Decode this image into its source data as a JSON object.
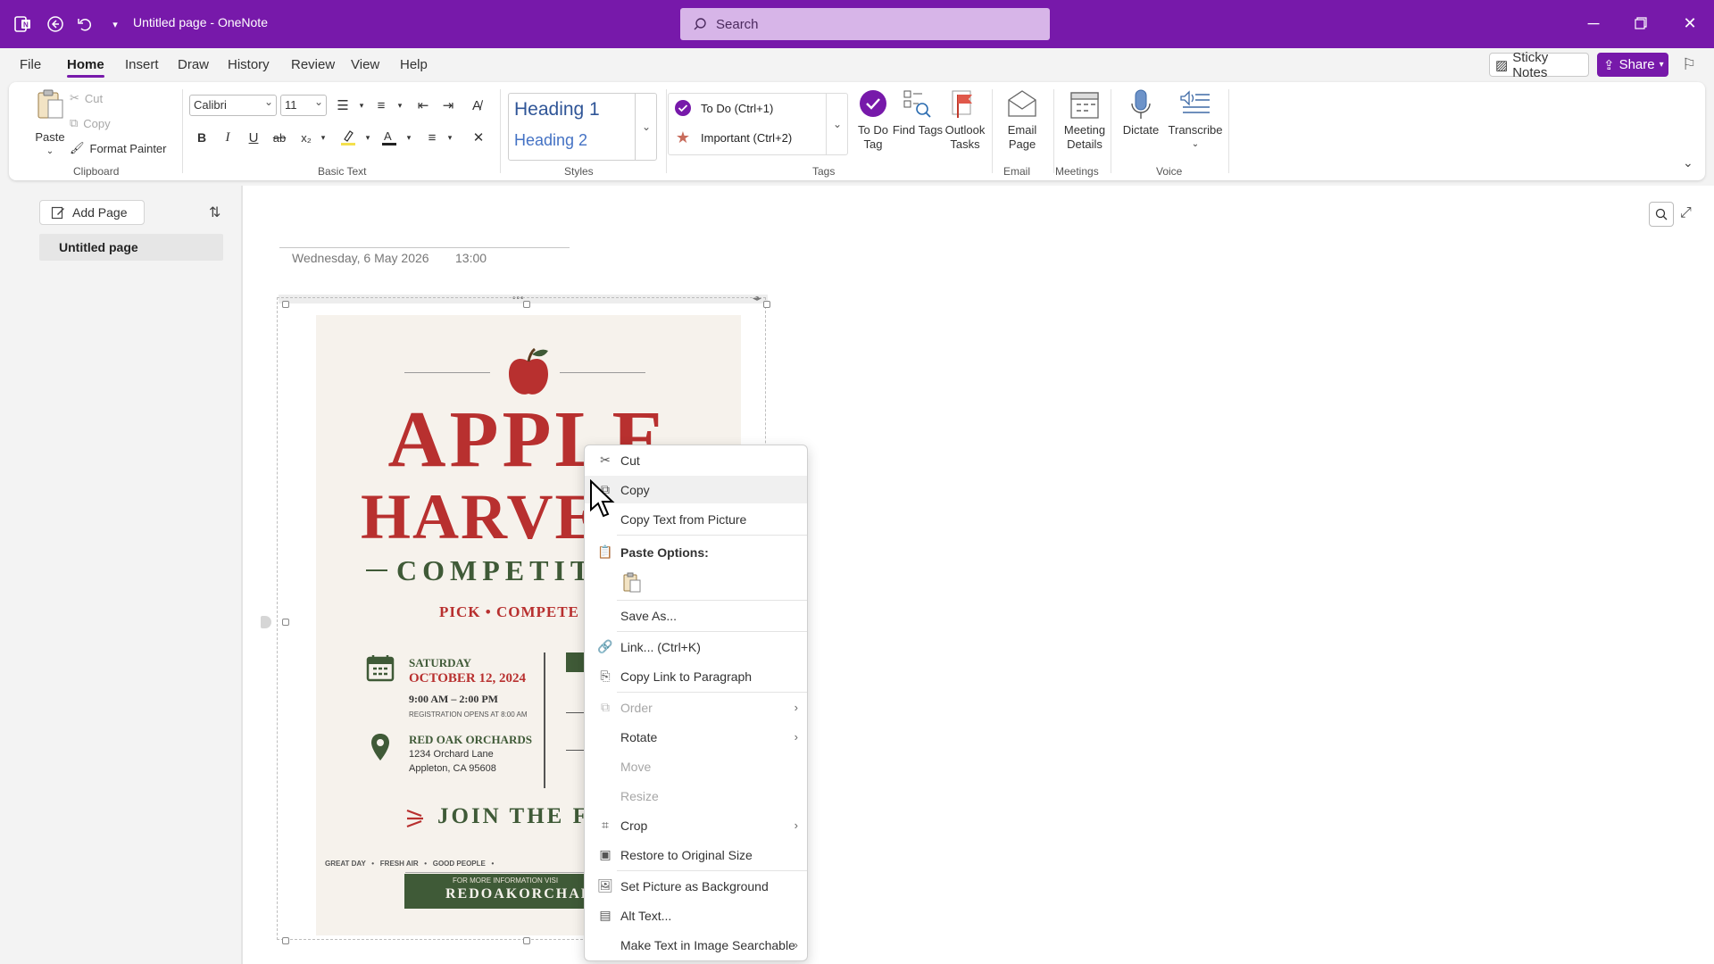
{
  "titlebar": {
    "doc_title": "Untitled page  -  OneNote",
    "search_placeholder": "Search"
  },
  "menu": {
    "tabs": [
      "File",
      "Home",
      "Insert",
      "Draw",
      "History",
      "Review",
      "View",
      "Help"
    ],
    "active": "Home",
    "sticky_notes": "Sticky Notes",
    "share": "Share"
  },
  "ribbon": {
    "clipboard": {
      "paste": "Paste",
      "cut": "Cut",
      "copy": "Copy",
      "format_painter": "Format Painter",
      "group": "Clipboard"
    },
    "basic_text": {
      "font": "Calibri",
      "size": "11",
      "group": "Basic Text"
    },
    "styles": {
      "heading1": "Heading 1",
      "heading2": "Heading 2",
      "group": "Styles"
    },
    "tags": {
      "todo": "To Do (Ctrl+1)",
      "important": "Important (Ctrl+2)",
      "todo_tag": "To Do Tag",
      "find_tags": "Find Tags",
      "outlook_tasks": "Outlook Tasks",
      "group": "Tags"
    },
    "email": {
      "email_page": "Email Page",
      "group": "Email"
    },
    "meetings": {
      "meeting_details": "Meeting Details",
      "group": "Meetings"
    },
    "voice": {
      "dictate": "Dictate",
      "transcribe": "Transcribe",
      "group": "Voice"
    }
  },
  "sidebar": {
    "add_page": "Add Page",
    "pages": [
      "Untitled page"
    ]
  },
  "page": {
    "date": "Wednesday, 6 May 2026",
    "time": "13:00"
  },
  "poster": {
    "title1": "APPLE",
    "title2": "HARVEST",
    "title3": "COMPETITION",
    "tagline": "PICK • COMPETE •",
    "day": "SATURDAY",
    "date": "OCTOBER 12, 2024",
    "hours": "9:00 AM – 2:00 PM",
    "registration": "REGISTRATION OPENS AT 8:00 AM",
    "venue": "RED OAK ORCHARDS",
    "address1": "1234 Orchard Lane",
    "address2": "Appleton, CA 95608",
    "join": "JOIN THE FU",
    "perks": "GREAT DAY   •   FRESH AIR   •   GOOD PEOPLE   •",
    "info": "FOR MORE INFORMATION VISI",
    "website": "REDOAKORCHARDS.C",
    "colors": {
      "red": "#b8302f",
      "green": "#3f5a37",
      "paper": "#f6f2ec"
    }
  },
  "context_menu": {
    "items": [
      {
        "label": "Cut",
        "icon": "scissors-icon"
      },
      {
        "label": "Copy",
        "icon": "copy-icon"
      },
      {
        "label": "Copy Text from Picture",
        "icon": ""
      },
      {
        "label": "Paste Options:",
        "icon": "clipboard-icon"
      },
      {
        "label": "Save As...",
        "icon": ""
      },
      {
        "label": "Link...  (Ctrl+K)",
        "icon": "link-icon"
      },
      {
        "label": "Copy Link to Paragraph",
        "icon": "copy-link-icon"
      },
      {
        "label": "Order",
        "icon": "order-icon"
      },
      {
        "label": "Rotate",
        "icon": ""
      },
      {
        "label": "Move",
        "icon": ""
      },
      {
        "label": "Resize",
        "icon": ""
      },
      {
        "label": "Crop",
        "icon": "crop-icon"
      },
      {
        "label": "Restore to Original Size",
        "icon": "restore-size-icon"
      },
      {
        "label": "Set Picture as Background",
        "icon": "background-icon"
      },
      {
        "label": "Alt Text...",
        "icon": "alt-text-icon"
      },
      {
        "label": "Make Text in Image Searchable",
        "icon": ""
      }
    ]
  },
  "accent_color": "#7719aa"
}
